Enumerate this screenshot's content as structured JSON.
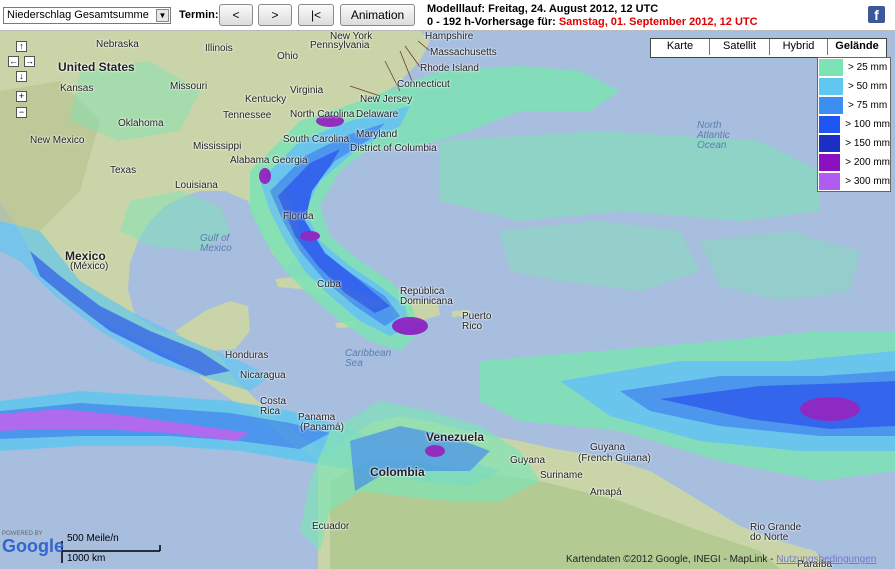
{
  "toolbar": {
    "product_select": "Niederschlag Gesamtsumme",
    "termin_label": "Termin:",
    "btn_prev": "<",
    "btn_next": ">",
    "btn_first": "|<",
    "btn_animation": "Animation",
    "modelllauf_line": "Modelllauf: Freitag, 24. August 2012, 12 UTC",
    "forecast_prefix": "0 - 192 h-Vorhersage für:",
    "forecast_target": "Samstag, 01. September 2012, 12 UTC",
    "share_icon": "facebook-icon"
  },
  "map_type": {
    "options": [
      "Karte",
      "Satellit",
      "Hybrid",
      "Gelände"
    ],
    "active": "Gelände"
  },
  "legend": [
    {
      "label": "> 25 mm",
      "color": "#7de3b5"
    },
    {
      "label": "> 50 mm",
      "color": "#5fc7f0"
    },
    {
      "label": "> 75 mm",
      "color": "#3c8ff0"
    },
    {
      "label": "> 100 mm",
      "color": "#1f55f0"
    },
    {
      "label": "> 150 mm",
      "color": "#1a2fc4"
    },
    {
      "label": "> 200 mm",
      "color": "#8a10c0"
    },
    {
      "label": "> 300 mm",
      "color": "#b05cf0"
    }
  ],
  "nav_controls": [
    "pan-up",
    "pan-left",
    "pan-right",
    "pan-down",
    "zoom-in",
    "zoom-out"
  ],
  "map_labels": {
    "united_states": "United States",
    "nebraska": "Nebraska",
    "illinois": "Illinois",
    "ohio": "Ohio",
    "pennsylvania": "Pennsylvania",
    "new_york": "New York",
    "hampshire": "Hampshire",
    "massachusetts": "Massachusetts",
    "rhode_island": "Rhode Island",
    "connecticut": "Connecticut",
    "new_jersey": "New Jersey",
    "kansas": "Kansas",
    "missouri": "Missouri",
    "kentucky": "Kentucky",
    "virginia": "Virginia",
    "delaware": "Delaware",
    "oklahoma": "Oklahoma",
    "tennessee": "Tennessee",
    "north_carolina": "North Carolina",
    "maryland": "Maryland",
    "new_mexico": "New Mexico",
    "mississippi": "Mississippi",
    "south_carolina": "South Carolina",
    "district_of_columbia": "District of Columbia",
    "alabama": "Alabama",
    "georgia": "Georgia",
    "texas": "Texas",
    "louisiana": "Louisiana",
    "florida": "Florida",
    "north_atlantic": "North Atlantic Ocean",
    "gulf_of_mexico": "Gulf of Mexico",
    "mexico": "Mexico",
    "mexico_sub": "(México)",
    "cuba": "Cuba",
    "dominican": "República Dominicana",
    "puerto_rico": "Puerto Rico",
    "honduras": "Honduras",
    "caribbean": "Caribbean Sea",
    "nicaragua": "Nicaragua",
    "costa_rica": "Costa Rica",
    "panama": "Panama",
    "panama_sub": "(Panamá)",
    "venezuela": "Venezuela",
    "guyana": "Guyana",
    "french_guiana": "(French Guiana)",
    "colombia": "Colombia",
    "suriname": "Suriname",
    "amapa": "Amapá",
    "ecuador": "Ecuador",
    "rio_grande": "Rio Grande do Norte",
    "paraiba": "Paraíba"
  },
  "google": {
    "powered_by": "POWERED BY",
    "brand": "Google"
  },
  "scale": {
    "miles": "500 Meile/n",
    "km": "1000 km"
  },
  "attribution": {
    "text": "Kartendaten ©2012 Google, INEGI - ",
    "maplink": "MapLink",
    "sep": " - ",
    "terms": "Nutzungsbedingungen"
  }
}
